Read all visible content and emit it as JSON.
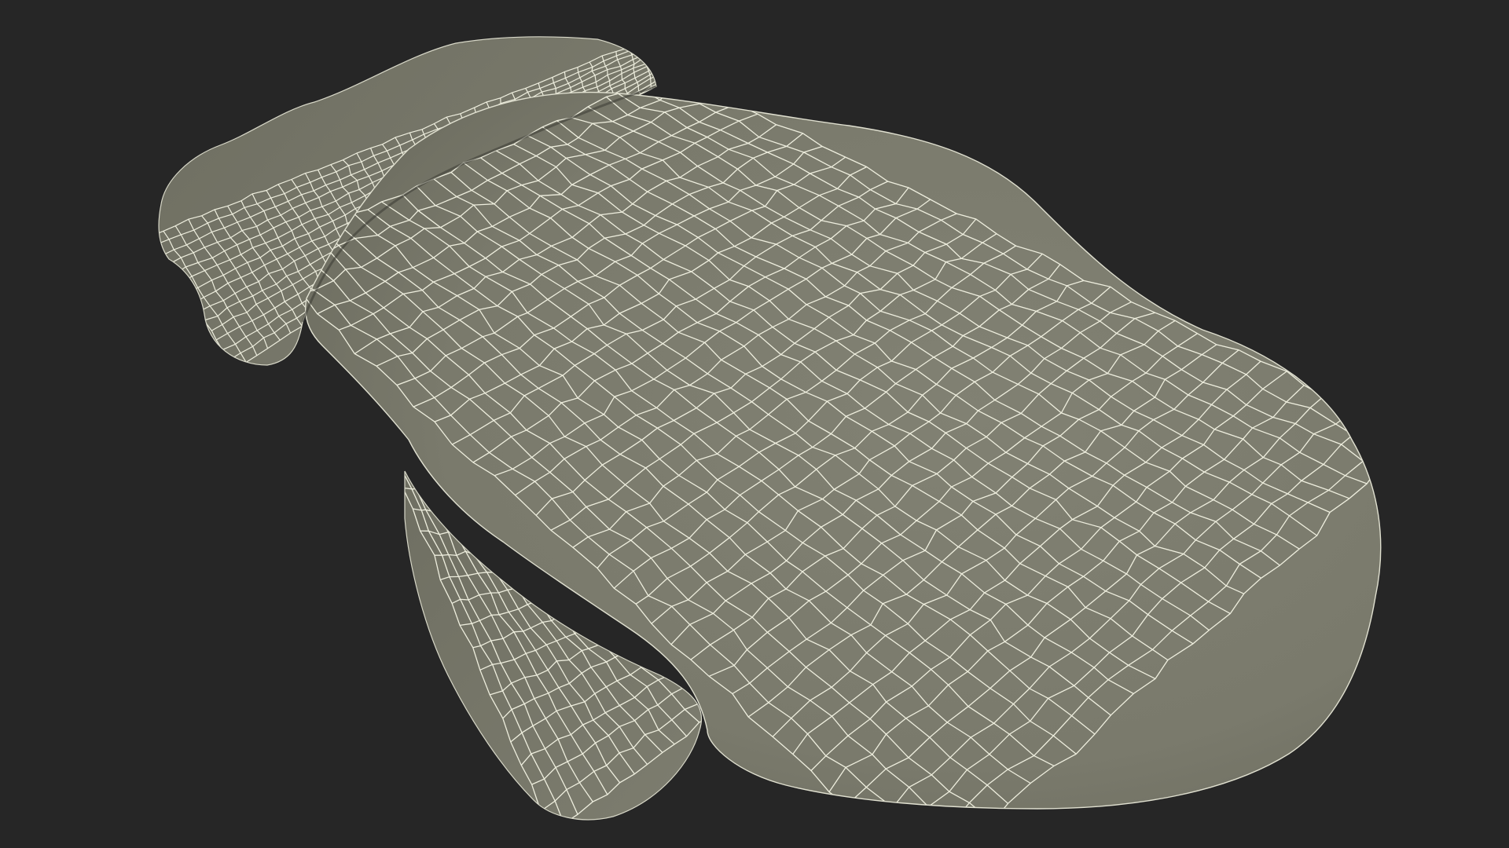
{
  "scene": {
    "background_color": "#262626",
    "mesh_fill_color": "#7a7a6c",
    "mesh_fill_shadow_color": "#646457",
    "wire_color": "#eeeede",
    "object": "mitten-wireframe-mesh",
    "render_style": "wireframe-over-shaded"
  }
}
